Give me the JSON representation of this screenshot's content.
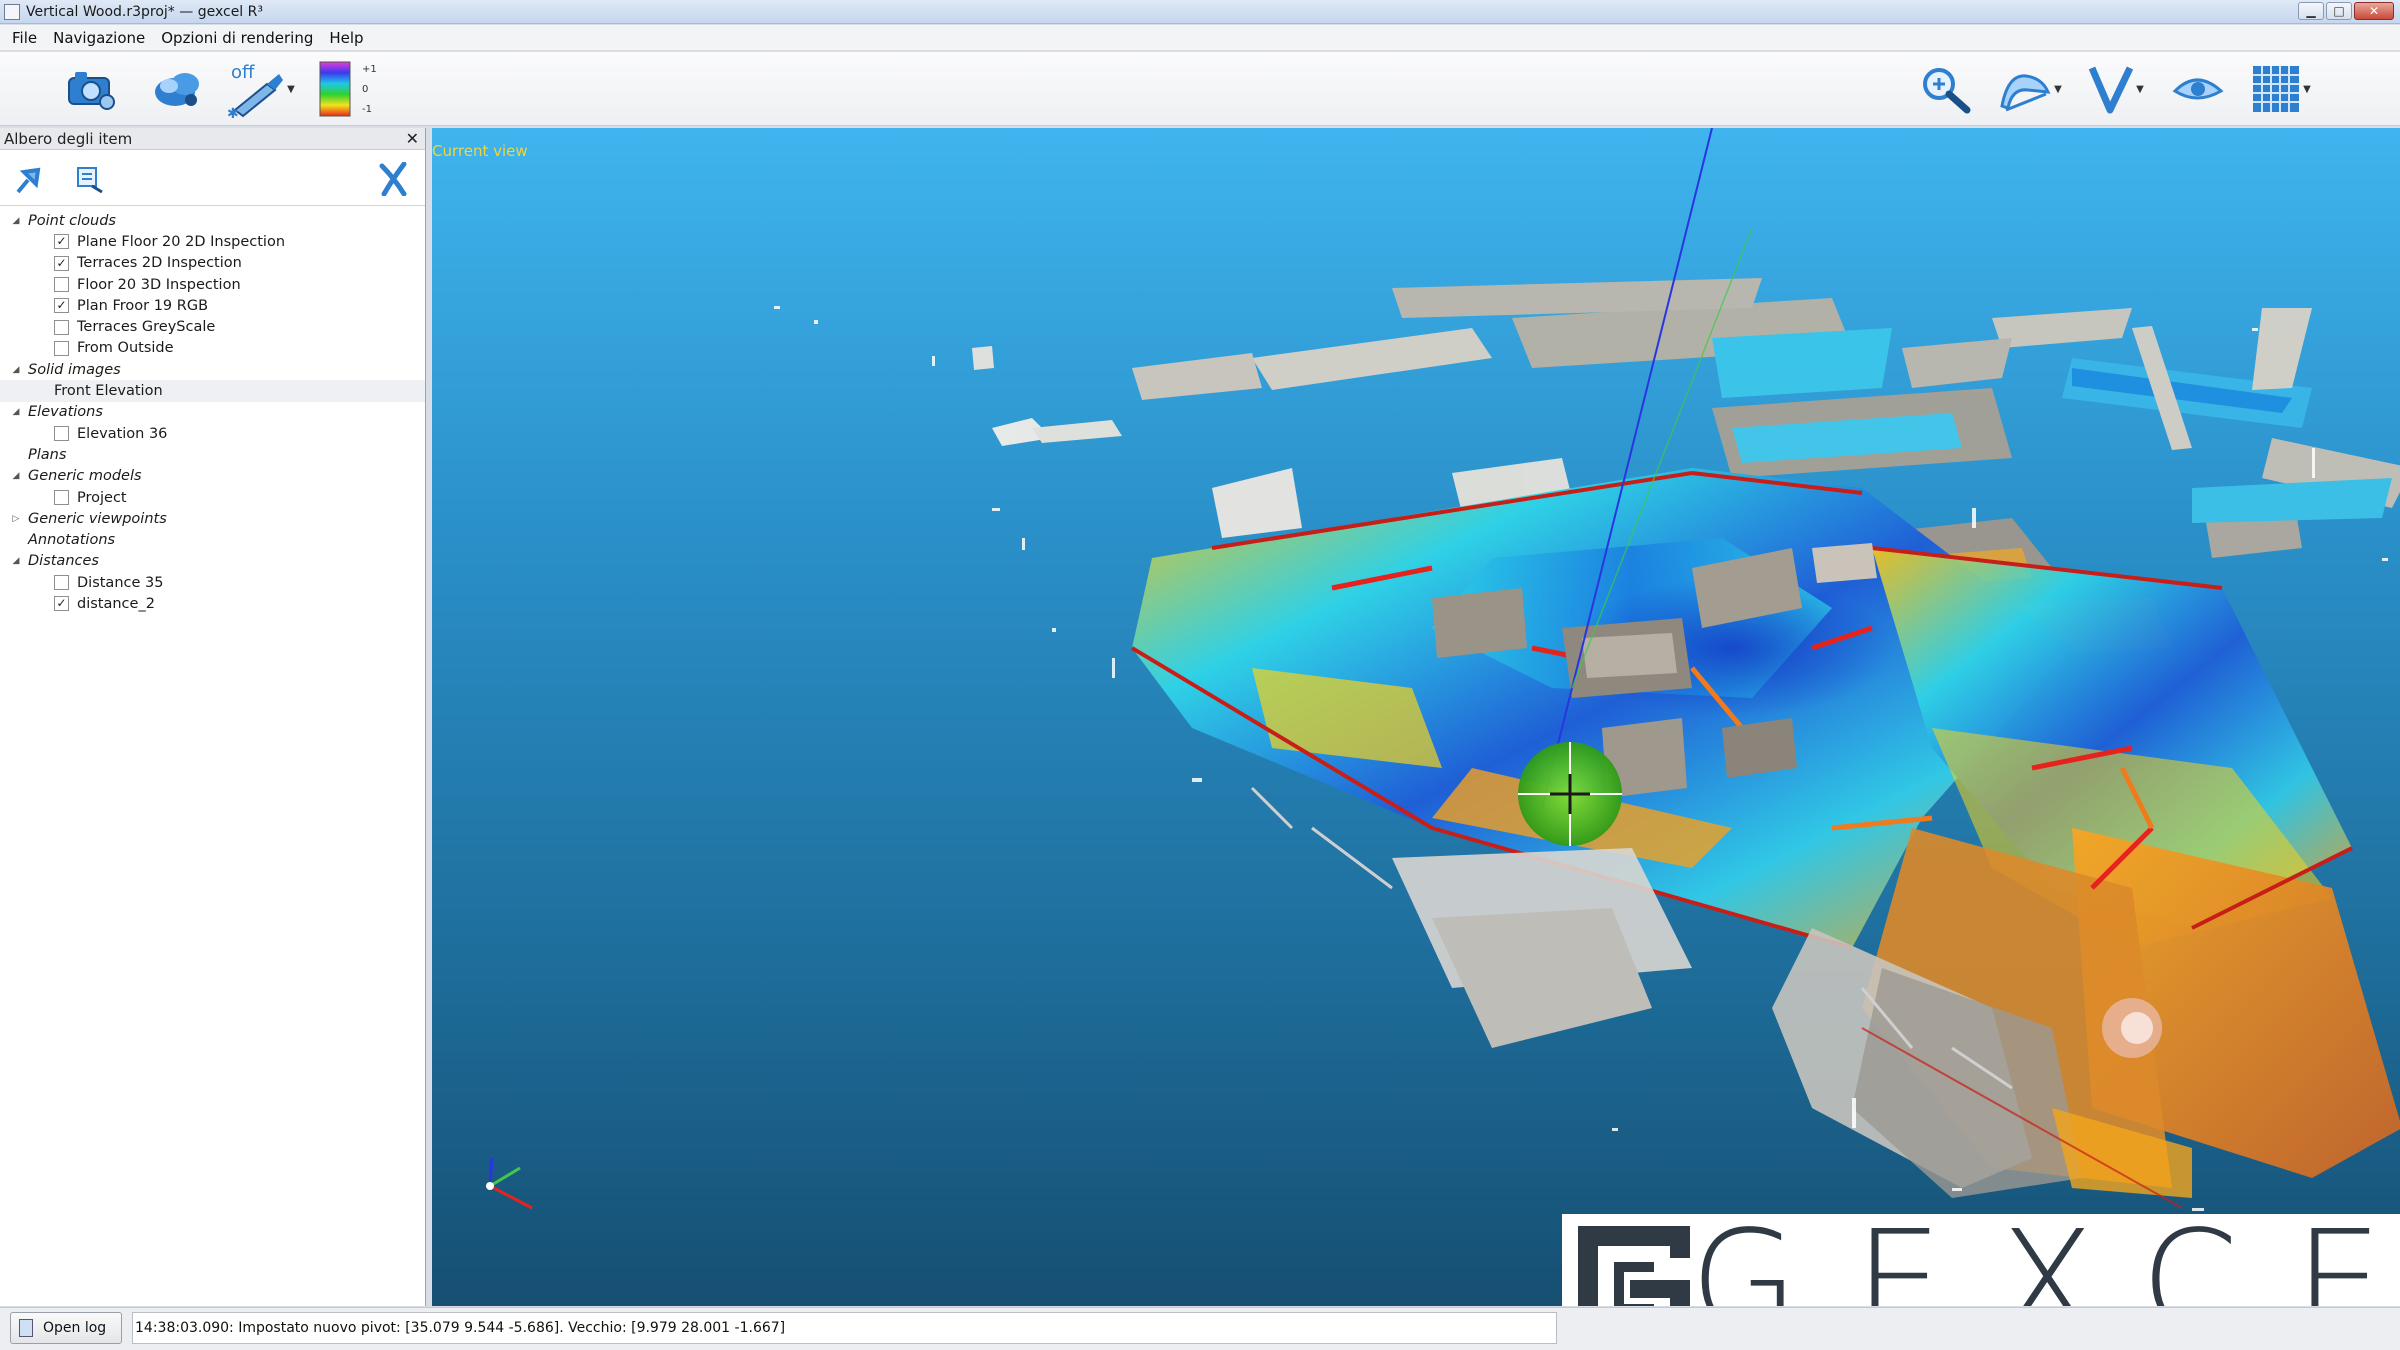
{
  "window": {
    "title": "Vertical Wood.r3proj* — gexcel R³",
    "minimize_label": "▁",
    "maximize_label": "□",
    "close_label": "✕"
  },
  "menu": {
    "items": [
      {
        "label": "File"
      },
      {
        "label": "Navigazione"
      },
      {
        "label": "Opzioni di rendering"
      },
      {
        "label": "Help"
      }
    ]
  },
  "toolbar": {
    "left_buttons": [
      "camera-icon",
      "point-cloud-icon",
      "off-tool-icon",
      "color-ramp-icon"
    ],
    "off_label": "off",
    "ramp_labels": [
      "+1",
      "0",
      "-1"
    ],
    "right_buttons": [
      "zoom-icon",
      "navigation-mode-icon",
      "view-icon",
      "eye-icon",
      "grid-icon"
    ]
  },
  "panel": {
    "title": "Albero degli item",
    "close_label": "✕",
    "tools": [
      "pin-icon",
      "properties-icon",
      "delete-icon"
    ],
    "tree": {
      "point_clouds": {
        "label": "Point clouds",
        "items": [
          {
            "label": "Plane Floor 20 2D Inspection",
            "checked": true
          },
          {
            "label": "Terraces 2D Inspection",
            "checked": true
          },
          {
            "label": "Floor 20 3D Inspection",
            "checked": false
          },
          {
            "label": "Plan Froor 19 RGB",
            "checked": true
          },
          {
            "label": "Terraces GreyScale",
            "checked": false
          },
          {
            "label": "From Outside",
            "checked": false
          }
        ]
      },
      "solid_images": {
        "label": "Solid images",
        "items": [
          {
            "label": "Front Elevation"
          }
        ]
      },
      "elevations": {
        "label": "Elevations",
        "items": [
          {
            "label": "Elevation 36",
            "checked": false
          }
        ]
      },
      "plans": {
        "label": "Plans"
      },
      "generic_models": {
        "label": "Generic models",
        "items": [
          {
            "label": "Project",
            "checked": false
          }
        ]
      },
      "generic_viewpoints": {
        "label": "Generic viewpoints"
      },
      "annotations": {
        "label": "Annotations"
      },
      "distances": {
        "label": "Distances",
        "items": [
          {
            "label": "Distance 35",
            "checked": false
          },
          {
            "label": "distance_2",
            "checked": true
          }
        ]
      }
    }
  },
  "viewport": {
    "label": "Current view",
    "label_color": "#f3d43a",
    "logo_text": "GEXCEL"
  },
  "status": {
    "open_log_label": "Open log",
    "message": "14:38:03.090: Impostato nuovo pivot: [35.079 9.544 -5.686]. Vecchio: [9.979 28.001 -1.667]"
  },
  "colors": {
    "sky_top": "#3fb4ee",
    "sky_bottom": "#164f72",
    "hot": "#e5231c",
    "warm": "#f5a623",
    "cool": "#1f5fd6",
    "neutral": "#d9d9d9"
  }
}
